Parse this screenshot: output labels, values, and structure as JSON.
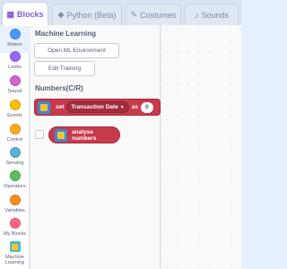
{
  "tabs": [
    {
      "label": "Blocks",
      "icon": "blocks-icon",
      "active": true
    },
    {
      "label": "Python (Beta)",
      "icon": "python-icon",
      "active": false
    },
    {
      "label": "Costumes",
      "icon": "brush-icon",
      "active": false
    },
    {
      "label": "Sounds",
      "icon": "speaker-icon",
      "active": false
    }
  ],
  "categories": [
    {
      "label": "Motion",
      "color": "#4c97ff"
    },
    {
      "label": "Looks",
      "color": "#9966ff"
    },
    {
      "label": "Sound",
      "color": "#cf63cf"
    },
    {
      "label": "Events",
      "color": "#ffbf00"
    },
    {
      "label": "Control",
      "color": "#ffab19"
    },
    {
      "label": "Sensing",
      "color": "#5cb1d6"
    },
    {
      "label": "Operators",
      "color": "#59c059"
    },
    {
      "label": "Variables",
      "color": "#ff8c1a"
    },
    {
      "label": "My Blocks",
      "color": "#ff6680"
    },
    {
      "label": "Machine Learning",
      "color": "#4fb7c8"
    }
  ],
  "palette": {
    "ml_title": "Machine Learning",
    "open_ml_button": "Open ML Environment",
    "edit_training_button": "Edit Training",
    "numbers_title": "Numbers(C/R)",
    "set_block": {
      "set_label": "set",
      "dropdown_value": "Transaction Date",
      "as_label": "as",
      "value": "0"
    },
    "analyse_block": {
      "label": "analyse numbers"
    }
  },
  "colors": {
    "accent": "#855cd6",
    "block": "#c73a4b"
  }
}
